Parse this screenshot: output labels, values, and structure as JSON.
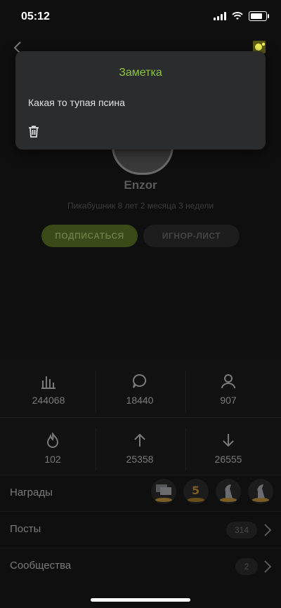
{
  "status": {
    "time": "05:12"
  },
  "profile": {
    "username": "Enzor",
    "tenure": "Пикабушник 8 лет 2 месяца 3 недели",
    "subscribe_label": "ПОДПИСАТЬСЯ",
    "ignore_label": "ИГНОР-ЛИСТ"
  },
  "stats": {
    "rating": "244068",
    "comments": "18440",
    "subscribers": "907",
    "hot": "102",
    "pluses": "25358",
    "minuses": "26555"
  },
  "rows": {
    "awards_label": "Награды",
    "posts_label": "Посты",
    "posts_count": "314",
    "communities_label": "Сообщества",
    "communities_count": "2"
  },
  "awards": [
    "comments-award-icon",
    "five-years-award-icon",
    "chess-award-icon",
    "chess-award-icon-2"
  ],
  "note_popup": {
    "title": "Заметка",
    "text": "Какая то тупая псина"
  },
  "colors": {
    "accent": "#8cc63f",
    "popup_bg": "#2b2c2e",
    "background": "#0f0f10"
  }
}
